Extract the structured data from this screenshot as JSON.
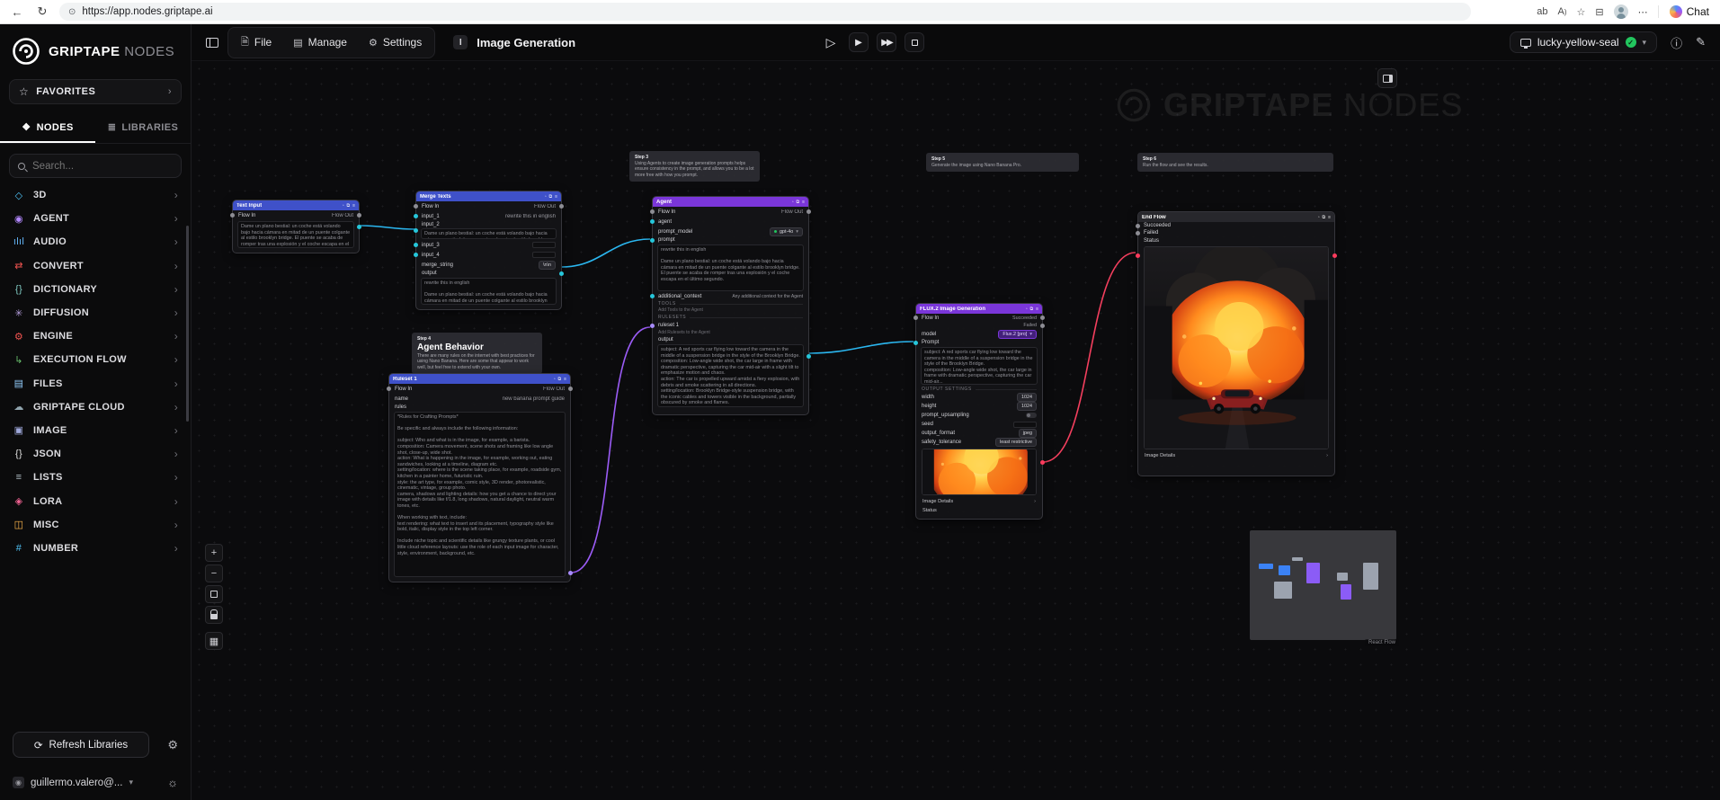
{
  "colors": {
    "edge_blue": "#2bb7f0",
    "edge_purple": "#9b5cf6",
    "edge_red": "#f43f5e",
    "accent_blue": "#3f51c9",
    "accent_purple": "#7a36d9",
    "status_green": "#22c55e"
  },
  "browser": {
    "url": "https://app.nodes.griptape.ai",
    "chat_label": "Chat"
  },
  "toolbar": {
    "file": "File",
    "manage": "Manage",
    "settings": "Settings",
    "workflow_badge": "I",
    "workflow_title": "Image Generation",
    "connection_name": "lucky-yellow-seal"
  },
  "sidebar": {
    "brand_primary": "GRIPTAPE",
    "brand_secondary": "NODES",
    "favorites": "FAVORITES",
    "tab_nodes": "NODES",
    "tab_libraries": "LIBRARIES",
    "search_placeholder": "Search...",
    "categories": [
      {
        "label": "3D",
        "glyph": "◇",
        "color": "#4fc3f7"
      },
      {
        "label": "AGENT",
        "glyph": "◉",
        "color": "#b388ff"
      },
      {
        "label": "AUDIO",
        "glyph": "ılıl",
        "color": "#64b5f6"
      },
      {
        "label": "CONVERT",
        "glyph": "⇄",
        "color": "#ef5350"
      },
      {
        "label": "DICTIONARY",
        "glyph": "{}",
        "color": "#80cbc4"
      },
      {
        "label": "DIFFUSION",
        "glyph": "✳",
        "color": "#b39ddb"
      },
      {
        "label": "ENGINE",
        "glyph": "⚙",
        "color": "#ef5350"
      },
      {
        "label": "EXECUTION FLOW",
        "glyph": "↳",
        "color": "#66bb6a"
      },
      {
        "label": "FILES",
        "glyph": "▤",
        "color": "#90caf9"
      },
      {
        "label": "GRIPTAPE CLOUD",
        "glyph": "☁",
        "color": "#90a4ae"
      },
      {
        "label": "IMAGE",
        "glyph": "▣",
        "color": "#9fa8da"
      },
      {
        "label": "JSON",
        "glyph": "{}",
        "color": "#e0e0e0"
      },
      {
        "label": "LISTS",
        "glyph": "≡",
        "color": "#b0bec5"
      },
      {
        "label": "LORA",
        "glyph": "◈",
        "color": "#f06292"
      },
      {
        "label": "MISC",
        "glyph": "◫",
        "color": "#ffb74d"
      },
      {
        "label": "NUMBER",
        "glyph": "#",
        "color": "#4fc3f7"
      }
    ],
    "refresh_button": "Refresh Libraries",
    "user_email": "guillermo.valero@..."
  },
  "canvas": {
    "watermark_primary": "GRIPTAPE",
    "watermark_secondary": "NODES",
    "attribution": "React Flow",
    "notes": {
      "step3": {
        "title": "Step 3",
        "text": "Using Agents to create image generation prompts helps ensure consistency in the prompt, and allows you to be a lot more free with how you prompt."
      },
      "step4": {
        "title": "Step 4",
        "heading": "Agent Behavior",
        "text": "There are many rules on the internet with best practices for using Nano Banana. Here are some that appear to work well, but feel free to extend with your own."
      },
      "step5": {
        "title": "Step 5",
        "text": "Generate the image using Nano Banana Pro."
      },
      "step6": {
        "title": "Step 6",
        "text": "Run the flow and see the results."
      }
    },
    "nodes": {
      "textInput": {
        "title": "Text Input",
        "flow_in": "Flow In",
        "flow_out": "Flow Out",
        "text": "Dame un plano bestial: un coche está volando bajo hacia cámara en mitad de un puente colgante al estilo brooklyn bridge. El puente se acaba de romper tras una explosión y el coche escapa en el último segundo."
      },
      "merge": {
        "title": "Merge Texts",
        "flow_in": "Flow In",
        "flow_out": "Flow Out",
        "input_1_label": "input_1",
        "input_1": "rewrite this in english",
        "input_2_label": "input_2",
        "input_2": "Dame un plano bestial: un coche está volando bajo hacia cámara en mitad de un puente colgante al estilo brooklyn bridge...",
        "input_3_label": "input_3",
        "input_4_label": "input_4",
        "merge_string_label": "merge_string",
        "merge_string": "\\n\\n",
        "output_label": "output",
        "output": "rewrite this in english\n\nDame un plano bestial: un coche está volando bajo hacia cámara en mitad de un puente colgante al estilo brooklyn bridge. El puente se acaba de romper tras una explosión..."
      },
      "agent": {
        "title": "Agent",
        "flow_in": "Flow In",
        "flow_out": "Flow Out",
        "agent_label": "agent",
        "prompt_model_label": "prompt_model",
        "prompt_model": "gpt-4o",
        "prompt_label": "prompt",
        "prompt": "rewrite this in english\n\nDame un plano bestial: un coche está volando bajo hacia cámara en mitad de un puente colgante al estilo brooklyn bridge. El puente se acaba de romper tras una explosión y el coche escapa en el último segundo.",
        "additional_context_label": "additional_context",
        "additional_context_hint": "Any additional context for the Agent",
        "tools_section": "TOOLS",
        "tools_hint": "Add Tools to the Agent",
        "rulesets_section": "RULESETS",
        "ruleset_label": "ruleset 1",
        "ruleset_hint": "Add Rulesets to the Agent",
        "output_label": "output",
        "output": "subject: A red sports car flying low toward the camera in the middle of a suspension bridge in the style of the Brooklyn Bridge.\ncomposition: Low-angle wide shot, the car large in frame with dramatic perspective, capturing the car mid-air with a slight tilt to emphasize motion and chaos.\naction: The car is propelled upward amidst a fiery explosion, with debris and smoke scattering in all directions.\nsetting/location: Brooklyn Bridge-style suspension bridge, with the iconic cables and towers visible in the background, partially obscured by smoke and flames.\nstyle: Hyper-realistic, cinematic action scene with intense detail on the car, explosion and environment.\ncamera, shadow and lighting details: Shot with a wide-angle lens, dramatic lighting with fiery orange and red tones from the explosion contrasting with the darker shadows of the bridge and smoke; high contrast and sharp detail on the debris and car."
      },
      "ruleset": {
        "title": "Ruleset 1",
        "flow_in": "Flow In",
        "flow_out": "Flow Out",
        "name_label": "name",
        "name": "new banana prompt guide",
        "rules_label": "rules",
        "rules": "*Rules for Crafting Prompts*\n\nBe specific and always include the following information:\n\nsubject: Who and what is in the image, for example, a barista.\ncomposition: Camera movement, scene shots and framing like low angle shot, close-up, wide shot.\naction: What is happening in the image, for example, working out, eating sandwiches, looking at a timeline, diagram etc.\nsetting/location: where is the scene taking place, for example, roadside gym, kitchen in a painter home, futuristic ruin.\nstyle: the art type, for example, comic style, 3D render, photorealistic, cinematic, vintage, group photo.\ncamera, shadows and lighting details: how you get a chance to direct your image with details like f/1.8, long shadows, natural daylight, neutral warm tones, etc.\n\nWhen working with text, include:\ntext rendering: what text to insert and its placement, typography style like bold, italic, display style in the top left corner.\n\nInclude niche topic and scientific details like grungy texture plants, or cool little cloud reference layouts: use the role of each input image for character, style, environment, background, etc."
      },
      "flux": {
        "title": "FLUX.2 Image Generation",
        "flow_in": "Flow In",
        "succeeded": "Succeeded",
        "failed": "Failed",
        "model_label": "model",
        "model": "Flux.2 [pro]",
        "prompt_label": "Prompt",
        "prompt": "subject: A red sports car flying low toward the camera in the middle of a suspension bridge in the style of the Brooklyn Bridge.\ncomposition: Low-angle wide shot, the car large in frame with dramatic perspective, capturing the car mid-air...",
        "output_settings_section": "OUTPUT SETTINGS",
        "width_label": "width",
        "width": "1024",
        "height_label": "height",
        "height": "1024",
        "upsampling_label": "prompt_upsampling",
        "seed_label": "seed",
        "format_label": "output_format",
        "format": "jpeg",
        "safety_label": "safety_tolerance",
        "safety": "least restrictive",
        "image_details": "Image Details",
        "status_label": "Status"
      },
      "end": {
        "title": "End Flow",
        "succeeded": "Succeeded",
        "failed": "Failed",
        "status_label": "Status",
        "image_details": "Image Details"
      }
    }
  }
}
